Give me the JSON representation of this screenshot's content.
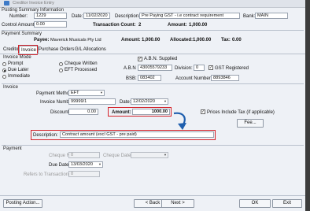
{
  "window": {
    "title": "Creditor Invoice Entry"
  },
  "posting_summary": {
    "section_label": "Posting Summary Information",
    "number_label": "Number:",
    "number_value": "1229",
    "date_label": "Date:",
    "date_value": "11/02/2020",
    "description_label": "Description:",
    "description_value": "Pre Paying GST - i.e contract requirement",
    "bank_label": "Bank:",
    "bank_value": "MAIN",
    "control_amount_label": "Control Amount:",
    "control_amount_value": "0.00",
    "transaction_count_label": "Transaction Count:",
    "transaction_count_value": "2",
    "amount_label": "Amount:",
    "amount_value": "1,000.00"
  },
  "payment_summary": {
    "section_label": "Payment Summary",
    "payee_label": "Payee:",
    "payee_value": "Maverick Musicals Pty Ltd",
    "amount_label": "Amount:",
    "amount_value": "1,000.00",
    "allocated_label": "Allocated:",
    "allocated_value": "1,000.00",
    "tax_label": "Tax:",
    "tax_value": "0.00"
  },
  "tabs": [
    {
      "label": "Creditor"
    },
    {
      "label": "Invoice"
    },
    {
      "label": "Purchase Orders"
    },
    {
      "label": "G/L Allocations"
    }
  ],
  "invoice_mode": {
    "section_label": "Invoice Mode",
    "options": [
      "Prompt",
      "Due Later",
      "Immediate",
      "Cheque Written",
      "EFT Processed"
    ],
    "selected": "Due Later"
  },
  "abn": {
    "supplied_label": "A.B.N. Supplied",
    "supplied_checked": true,
    "abn_label": "A.B.N",
    "abn_value": "43005579233",
    "division_label": "Division:",
    "division_value": "0",
    "gst_registered_label": "GST Registered",
    "gst_registered_checked": true,
    "bsb_label": "BSB:",
    "bsb_value": "083402",
    "account_number_label": "Account Number:",
    "account_number_value": "8893846"
  },
  "invoice": {
    "section_label": "Invoice",
    "payment_method_label": "Payment Method:",
    "payment_method_value": "EFT",
    "invoice_number_label": "Invoice Number:",
    "invoice_number_value": "99999/1",
    "date_label": "Date:",
    "date_value": "12/02/2020",
    "discount_label": "Discount:",
    "discount_value": "0.00",
    "amount_label": "Amount:",
    "amount_value": "1000.00",
    "prices_include_tax_label": "Prices Include Tax (if applicable)",
    "prices_include_tax_checked": true,
    "fee_button": "Fee...",
    "description_label": "Description:",
    "description_value": "Contract amount (excl GST - pre paid)"
  },
  "payment": {
    "section_label": "Payment",
    "cheque_no_label": "Cheque No:",
    "cheque_no_value": "0",
    "cheque_date_label": "Cheque Date:",
    "cheque_date_value": "",
    "due_date_label": "Due Date:",
    "due_date_value": "13/03/2020",
    "refers_to_label": "Refers to Transaction:",
    "refers_to_value": "0"
  },
  "footer": {
    "posting_action": "Posting Action...",
    "back": "< Back",
    "next": "Next >",
    "ok": "OK",
    "exit": "Exit"
  },
  "colors": {
    "highlight": "#d5232a",
    "arrow": "#1f5fae"
  }
}
